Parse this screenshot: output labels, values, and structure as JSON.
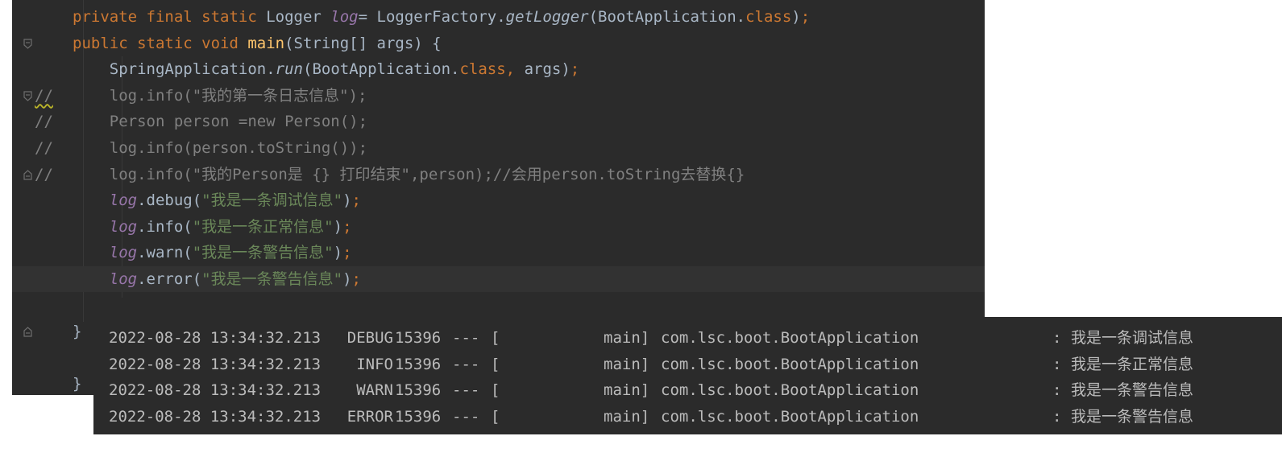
{
  "editor": {
    "lines": [
      {
        "tokens": [
          {
            "t": "private final static ",
            "c": "kw"
          },
          {
            "t": "Logger ",
            "c": "plain"
          },
          {
            "t": "log",
            "c": "field"
          },
          {
            "t": "= LoggerFactory.",
            "c": "plain"
          },
          {
            "t": "getLogger",
            "c": "plain it"
          },
          {
            "t": "(BootApplication.",
            "c": "plain"
          },
          {
            "t": "class",
            "c": "kw"
          },
          {
            "t": ")",
            "c": "plain"
          },
          {
            "t": ";",
            "c": "kw"
          }
        ]
      },
      {
        "tokens": [
          {
            "t": "public static void ",
            "c": "kw"
          },
          {
            "t": "main",
            "c": "fn"
          },
          {
            "t": "(String[] args) {",
            "c": "plain"
          }
        ]
      },
      {
        "tokens": [
          {
            "t": "    SpringApplication.",
            "c": "plain"
          },
          {
            "t": "run",
            "c": "plain it"
          },
          {
            "t": "(BootApplication.",
            "c": "plain"
          },
          {
            "t": "class",
            "c": "kw"
          },
          {
            "t": ", ",
            "c": "kw"
          },
          {
            "t": "args)",
            "c": "plain"
          },
          {
            "t": ";",
            "c": "kw"
          }
        ]
      },
      {
        "comment": "//",
        "tokens": [
          {
            "t": "    log.info(\"我的第一条日志信息\");",
            "c": "cmt"
          }
        ]
      },
      {
        "comment": "//",
        "tokens": [
          {
            "t": "    Person person =new Person();",
            "c": "cmt"
          }
        ]
      },
      {
        "comment": "//",
        "tokens": [
          {
            "t": "    log.info(person.toString());",
            "c": "cmt"
          }
        ]
      },
      {
        "comment": "//",
        "tokens": [
          {
            "t": "    log.info(\"我的Person是 {} 打印结束\",person);//会用person.toString去替换{}",
            "c": "cmt"
          }
        ]
      },
      {
        "tokens": [
          {
            "t": "    ",
            "c": "plain"
          },
          {
            "t": "log",
            "c": "field"
          },
          {
            "t": ".debug(",
            "c": "plain"
          },
          {
            "t": "\"我是一条调试信息\"",
            "c": "str"
          },
          {
            "t": ")",
            "c": "plain"
          },
          {
            "t": ";",
            "c": "kw"
          }
        ]
      },
      {
        "tokens": [
          {
            "t": "    ",
            "c": "plain"
          },
          {
            "t": "log",
            "c": "field"
          },
          {
            "t": ".info(",
            "c": "plain"
          },
          {
            "t": "\"我是一条正常信息\"",
            "c": "str"
          },
          {
            "t": ")",
            "c": "plain"
          },
          {
            "t": ";",
            "c": "kw"
          }
        ]
      },
      {
        "tokens": [
          {
            "t": "    ",
            "c": "plain"
          },
          {
            "t": "log",
            "c": "field"
          },
          {
            "t": ".warn(",
            "c": "plain"
          },
          {
            "t": "\"我是一条警告信息\"",
            "c": "str"
          },
          {
            "t": ")",
            "c": "plain"
          },
          {
            "t": ";",
            "c": "kw"
          }
        ]
      },
      {
        "tokens": [
          {
            "t": "    ",
            "c": "plain"
          },
          {
            "t": "log",
            "c": "field"
          },
          {
            "t": ".error(",
            "c": "plain"
          },
          {
            "t": "\"我是一条警告信息\"",
            "c": "str"
          },
          {
            "t": ")",
            "c": "plain"
          },
          {
            "t": ";",
            "c": "kw"
          }
        ]
      },
      {
        "tokens": []
      },
      {
        "tokens": [
          {
            "t": "}",
            "c": "plain"
          }
        ]
      },
      {
        "tokens": []
      },
      {
        "tokens": [
          {
            "t": "}",
            "c": "plain"
          }
        ]
      }
    ]
  },
  "console": {
    "rows": [
      {
        "date": "2022-08-28 13:34:32.213",
        "level": "DEBUG",
        "pid": "15396",
        "sep": "---",
        "open": "[",
        "thread": "main]",
        "logger": "com.lsc.boot.BootApplication",
        "colon": ":",
        "message": "我是一条调试信息"
      },
      {
        "date": "2022-08-28 13:34:32.213",
        "level": "INFO",
        "pid": "15396",
        "sep": "---",
        "open": "[",
        "thread": "main]",
        "logger": "com.lsc.boot.BootApplication",
        "colon": ":",
        "message": "我是一条正常信息"
      },
      {
        "date": "2022-08-28 13:34:32.213",
        "level": "WARN",
        "pid": "15396",
        "sep": "---",
        "open": "[",
        "thread": "main]",
        "logger": "com.lsc.boot.BootApplication",
        "colon": ":",
        "message": "我是一条警告信息"
      },
      {
        "date": "2022-08-28 13:34:32.213",
        "level": "ERROR",
        "pid": "15396",
        "sep": "---",
        "open": "[",
        "thread": "main]",
        "logger": "com.lsc.boot.BootApplication",
        "colon": ":",
        "message": "我是一条警告信息"
      }
    ]
  },
  "colors": {
    "editor_bg": "#2b2b2b",
    "keyword": "#cc7832",
    "method": "#ffc66d",
    "field": "#9876aa",
    "string": "#6a8759",
    "comment": "#808080",
    "text": "#a9b7c6",
    "console_text": "#bbbbbb"
  }
}
